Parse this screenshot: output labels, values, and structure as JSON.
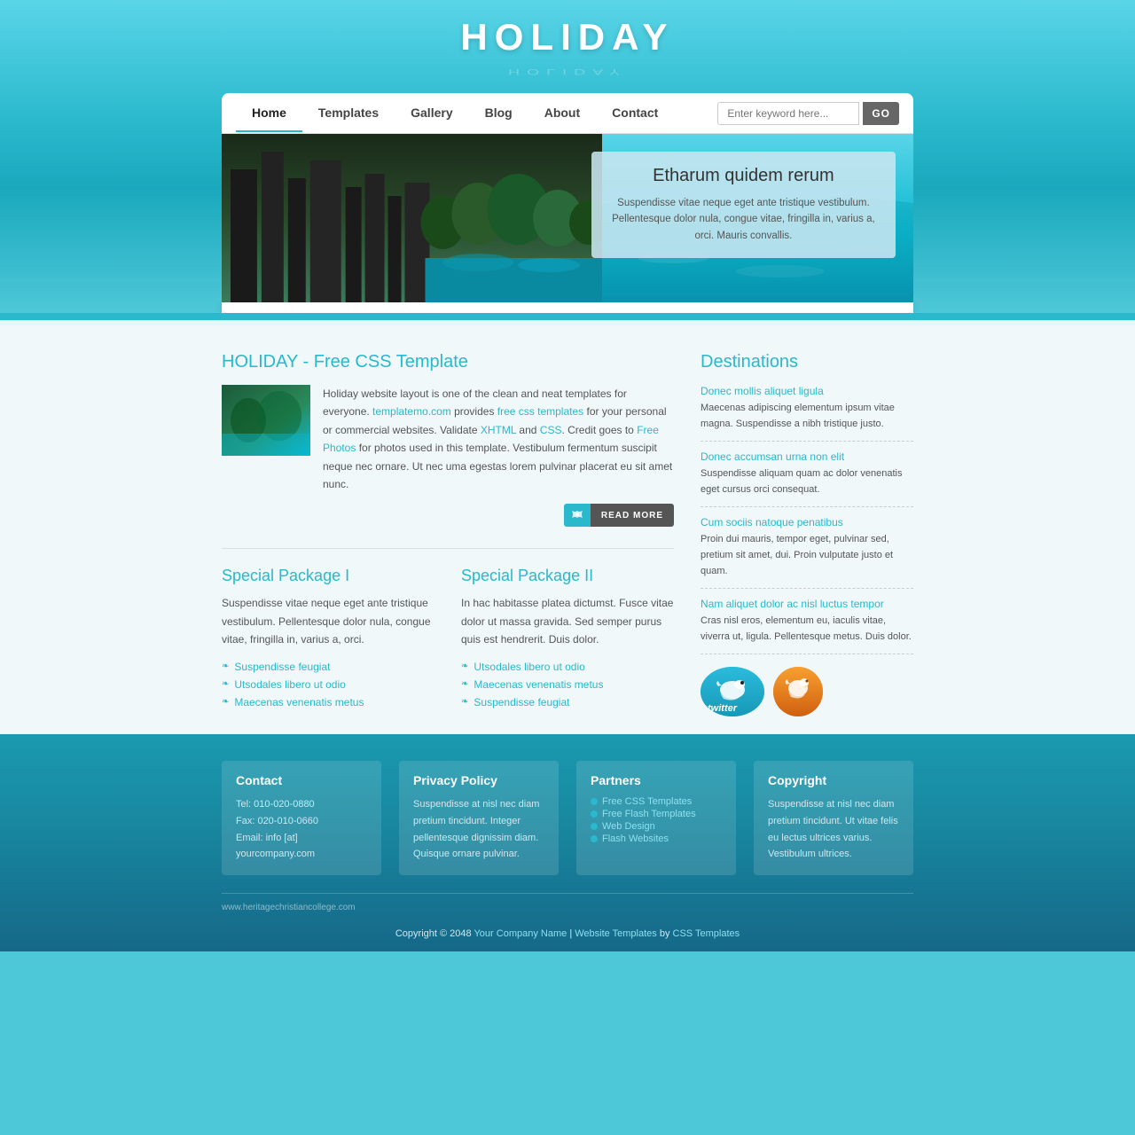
{
  "site": {
    "title": "HOLIDAY",
    "title_reflection": "HOLIDAY"
  },
  "nav": {
    "links": [
      {
        "label": "Home",
        "active": true
      },
      {
        "label": "Templates",
        "active": false
      },
      {
        "label": "Gallery",
        "active": false
      },
      {
        "label": "Blog",
        "active": false
      },
      {
        "label": "About",
        "active": false
      },
      {
        "label": "Contact",
        "active": false
      }
    ],
    "search_placeholder": "Enter keyword here...",
    "search_button": "GO"
  },
  "hero": {
    "heading": "Etharum quidem rerum",
    "text": "Suspendisse vitae neque eget ante tristique vestibulum. Pellentesque dolor nula, congue vitae, fringilla in, varius a, orci. Mauris convallis."
  },
  "about": {
    "heading": "HOLIDAY - Free CSS Template",
    "text1": "Holiday website layout is one of the clean and neat templates for everyone.",
    "link1": "templatemo.com",
    "text2": " provides ",
    "link2": "free css templates",
    "text3": " for your personal or commercial websites. Validate ",
    "link3": "XHTML",
    "text4": " and ",
    "link4": "CSS",
    "text5": ". Credit goes to ",
    "link5": "Free Photos",
    "text6": " for photos used in this template. Vestibulum fermentum suscipit neque nec ornare. Ut nec uma egestas lorem pulvinar placerat eu sit amet nunc.",
    "read_more": "READ MORE"
  },
  "packages": [
    {
      "heading": "Special Package I",
      "text": "Suspendisse vitae neque eget ante tristique vestibulum. Pellentesque dolor nula, congue vitae, fringilla in, varius a, orci.",
      "items": [
        "Suspendisse feugiat",
        "Utsodales libero ut odio",
        "Maecenas venenatis metus"
      ]
    },
    {
      "heading": "Special Package II",
      "text": "In hac habitasse platea dictumst. Fusce vitae dolor ut massa gravida. Sed semper purus quis est hendrerit. Duis dolor.",
      "items": [
        "Utsodales libero ut odio",
        "Maecenas venenatis metus",
        "Suspendisse feugiat"
      ]
    }
  ],
  "destinations": {
    "heading": "Destinations",
    "items": [
      {
        "title": "Donec mollis aliquet ligula",
        "text": "Maecenas adipiscing elementum ipsum vitae magna. Suspendisse a nibh tristique justo."
      },
      {
        "title": "Donec accumsan urna non elit",
        "text": "Suspendisse aliquam quam ac dolor venenatis eget cursus orci consequat."
      },
      {
        "title": "Cum sociis natoque penatibus",
        "text": "Proin dui mauris, tempor eget, pulvinar sed, pretium sit amet, dui. Proin vulputate justo et quam."
      },
      {
        "title": "Nam aliquet dolor ac nisl luctus tempor",
        "text": "Cras nisl eros, elementum eu, iaculis vitae, viverra ut, ligula. Pellentesque metus. Duis dolor."
      }
    ]
  },
  "footer": {
    "columns": [
      {
        "heading": "Contact",
        "lines": [
          "Tel: 010-020-0880",
          "Fax: 020-010-0660",
          "Email: info [at] yourcompany.com"
        ]
      },
      {
        "heading": "Privacy Policy",
        "text": "Suspendisse at nisl nec diam pretium tincidunt. Integer pellentesque dignissim diam. Quisque ornare pulvinar."
      },
      {
        "heading": "Partners",
        "links": [
          "Free CSS Templates",
          "Free Flash Templates",
          "Web Design",
          "Flash Websites"
        ]
      },
      {
        "heading": "Copyright",
        "text": "Suspendisse at nisl nec diam pretium tincidunt. Ut vitae felis eu lectus ultrices varius. Vestibulum ultrices."
      }
    ],
    "bottom_left": "www.heritagechristiancollege.com",
    "copyright_text": "Copyright © 2048 ",
    "copyright_link1": "Your Company Name",
    "copyright_sep1": " | ",
    "copyright_link2": "Website Templates",
    "copyright_sep2": " by ",
    "copyright_link3": "CSS Templates"
  }
}
